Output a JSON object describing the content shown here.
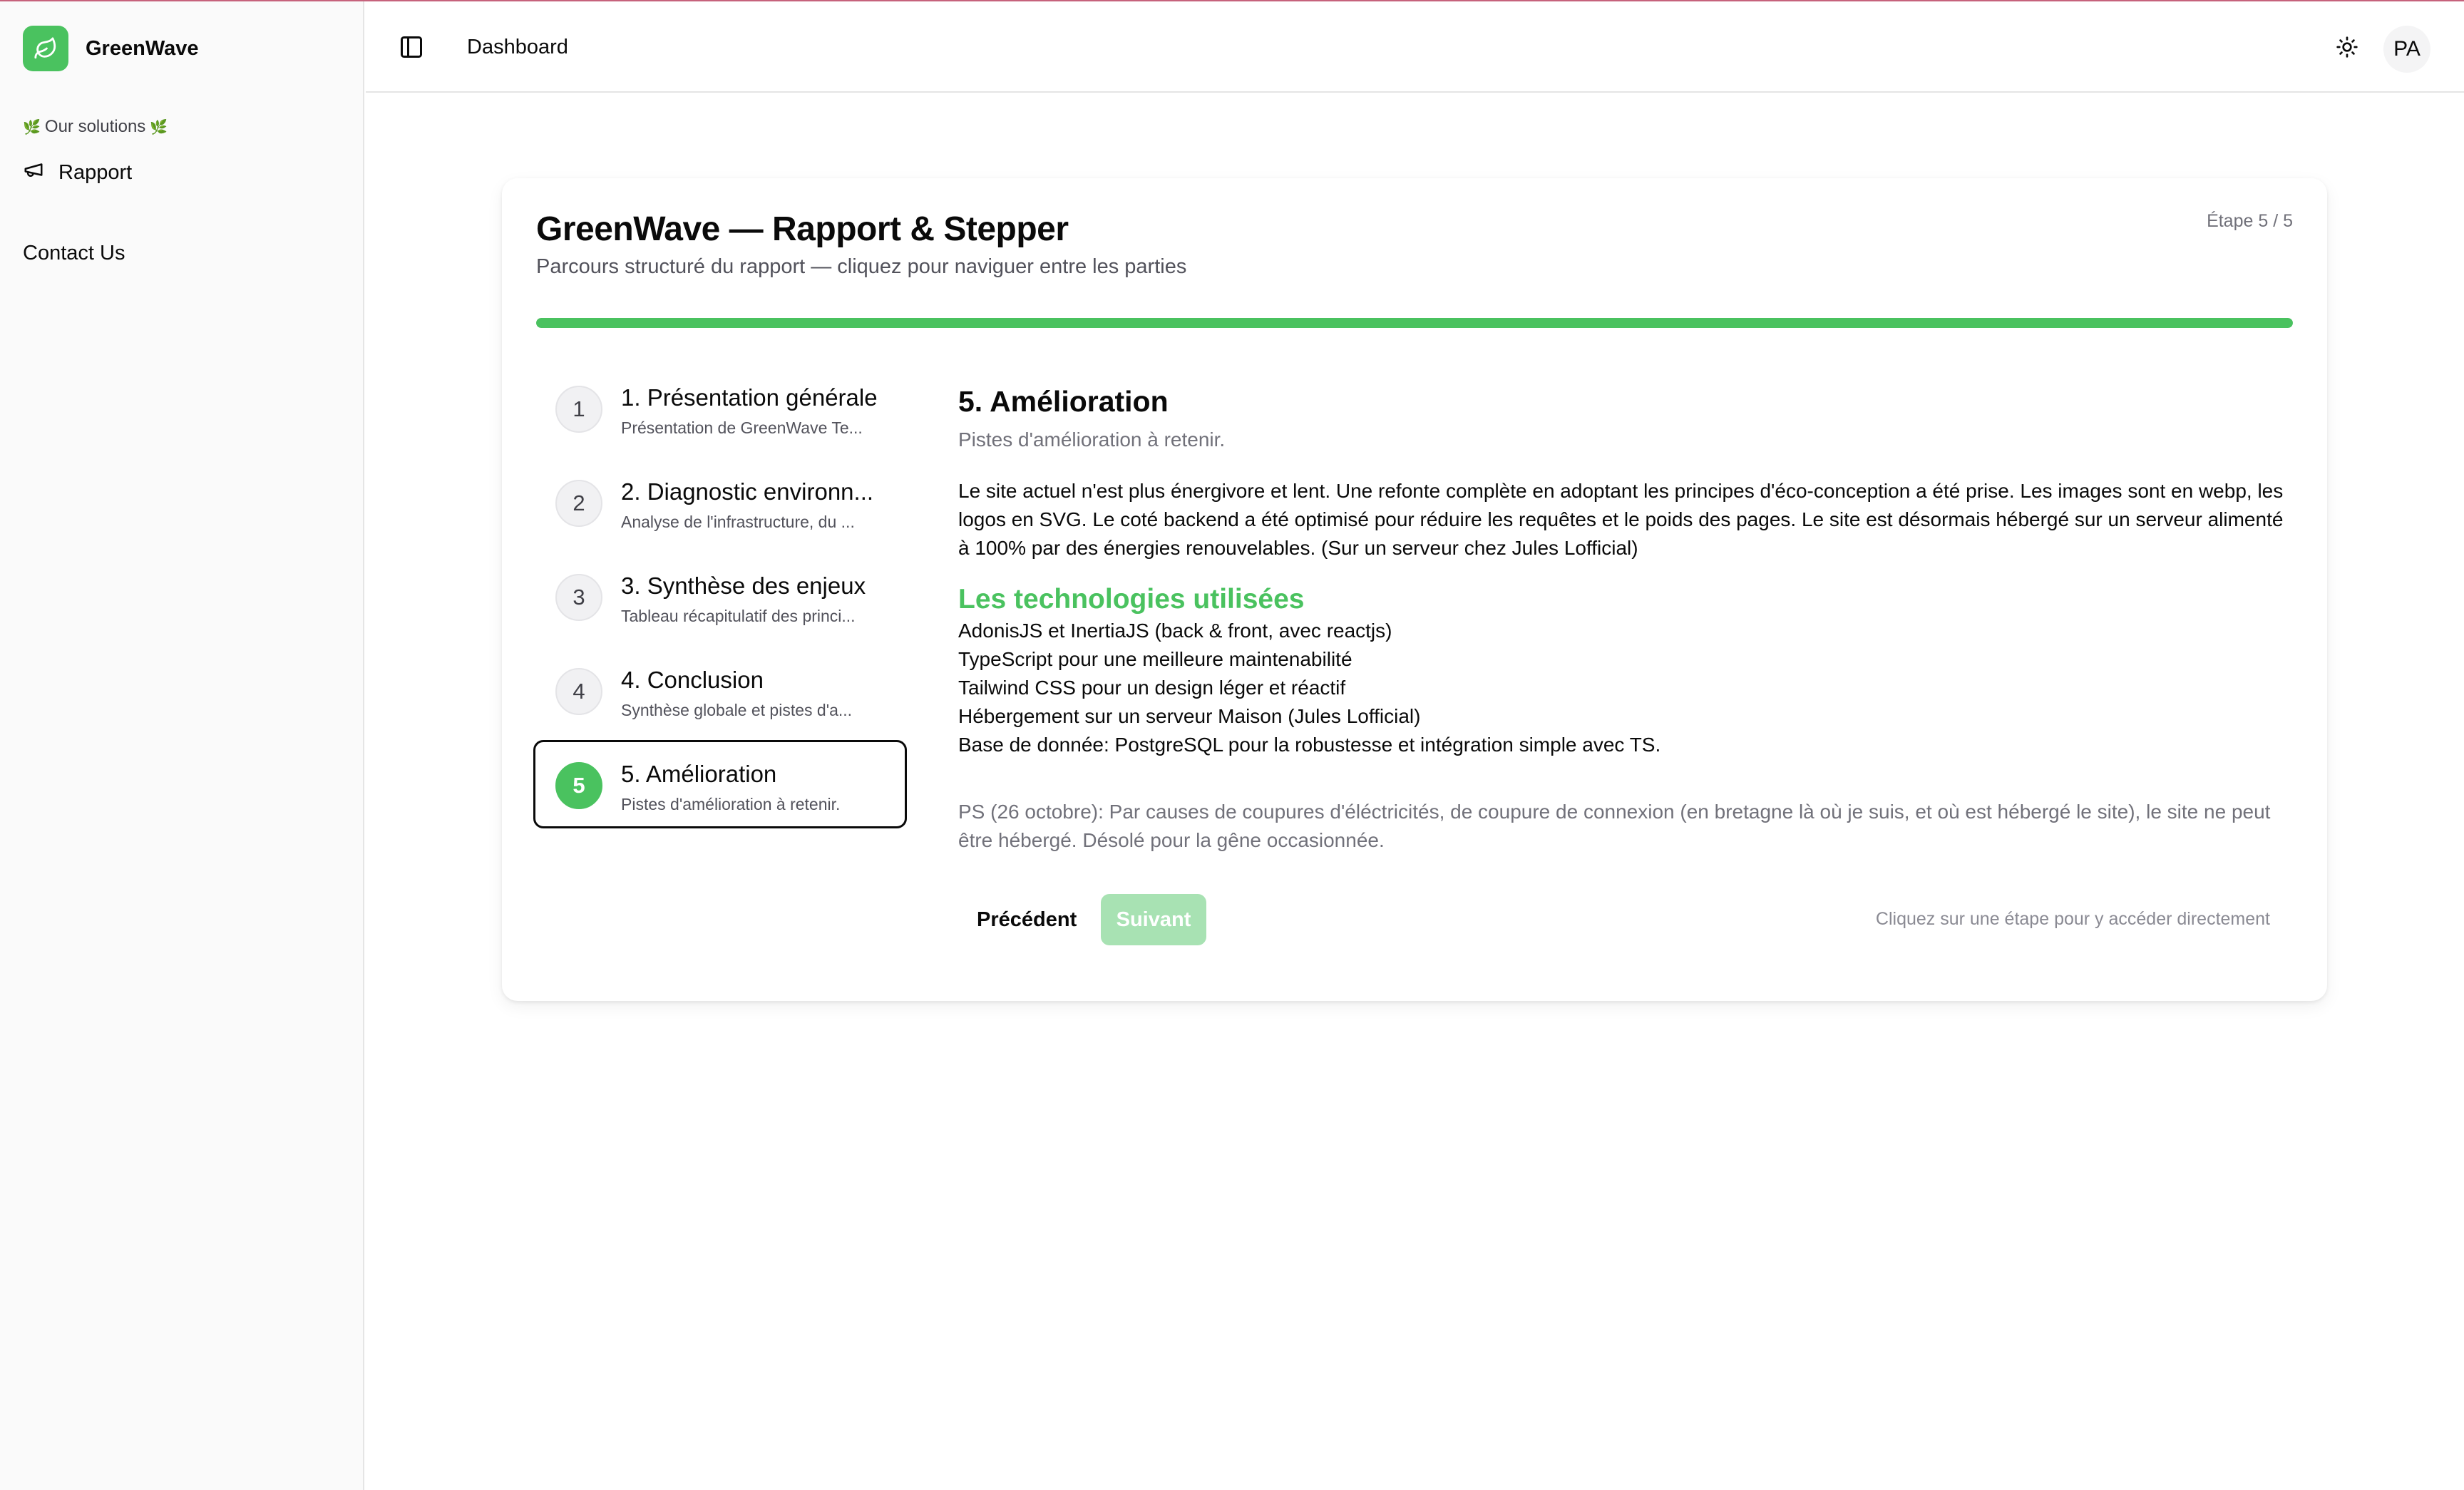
{
  "sidebar": {
    "brand": {
      "name": "GreenWave",
      "icon": "leaf-icon"
    },
    "group_label": "Our solutions",
    "group_emoji": "🌿",
    "nav_items": [
      {
        "label": "Rapport",
        "icon": "megaphone-icon"
      }
    ],
    "contact_label": "Contact Us"
  },
  "header": {
    "breadcrumb": "Dashboard",
    "toggle_icon": "sidebar-toggle-icon",
    "theme_icon": "sun-icon",
    "avatar_initials": "PA"
  },
  "card": {
    "title": "GreenWave — Rapport & Stepper",
    "subtitle": "Parcours structuré du rapport — cliquez pour naviguer entre les parties",
    "step_counter": "Étape 5 / 5",
    "progress_percent": 100,
    "steps": [
      {
        "number": "1",
        "title": "1. Présentation générale",
        "description": "Présentation de GreenWave Te..."
      },
      {
        "number": "2",
        "title": "2. Diagnostic environn...",
        "description": "Analyse de l'infrastructure, du ..."
      },
      {
        "number": "3",
        "title": "3. Synthèse des enjeux",
        "description": "Tableau récapitulatif des princi..."
      },
      {
        "number": "4",
        "title": "4. Conclusion",
        "description": "Synthèse globale et pistes d'a..."
      },
      {
        "number": "5",
        "title": "5. Amélioration",
        "description": "Pistes d'amélioration à retenir."
      }
    ],
    "active_step": 5,
    "content": {
      "heading": "5. Amélioration",
      "lead": "Pistes d'amélioration à retenir.",
      "paragraph": "Le site actuel n'est plus énergivore et lent. Une refonte complète en adoptant les principes d'éco-conception a été prise. Les images sont en webp, les logos en SVG. Le coté backend a été optimisé pour réduire les requêtes et le poids des pages. Le site est désormais hébergé sur un serveur alimenté à 100% par des énergies renouvelables. (Sur un serveur chez Jules Lofficial)",
      "tech_heading": "Les technologies utilisées",
      "tech_list": [
        "AdonisJS et InertiaJS (back & front, avec reactjs)",
        "TypeScript pour une meilleure maintenabilité",
        "Tailwind CSS pour un design léger et réactif",
        "Hébergement sur un serveur Maison (Jules Lofficial)",
        "Base de donnée: PostgreSQL pour la robustesse et intégration simple avec TS."
      ],
      "ps": "PS (26 octobre): Par causes de coupures d'éléctricités, de coupure de connexion (en bretagne là où je suis, et où est hébergé le site), le site ne peut être hébergé. Désolé pour la gêne occasionnée."
    },
    "buttons": {
      "prev_label": "Précédent",
      "next_label": "Suivant"
    },
    "hint": "Cliquez sur une étape pour y accéder directement"
  },
  "colors": {
    "accent": "#4ac25f",
    "accent_disabled": "#a8e2b3",
    "top_line": "#c6627c"
  }
}
